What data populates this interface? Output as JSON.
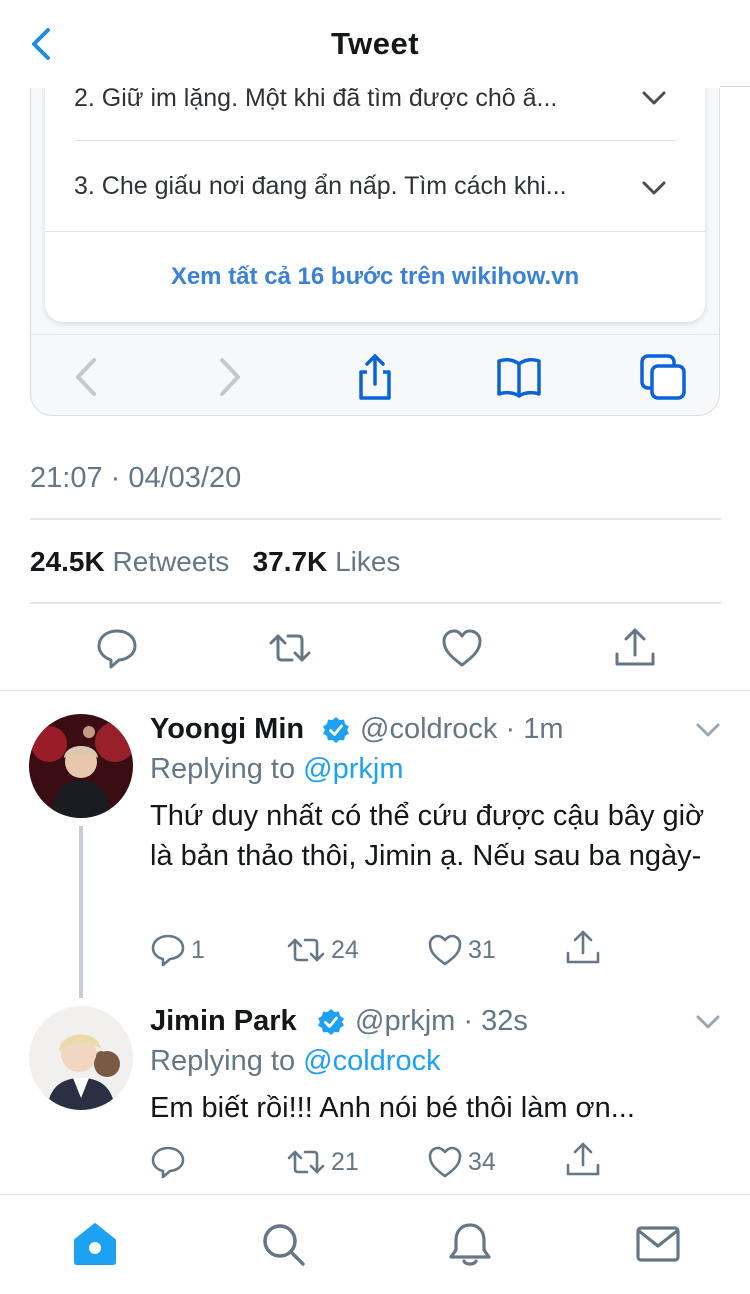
{
  "header": {
    "title": "Tweet",
    "back_icon": "back-chevron-icon"
  },
  "card": {
    "steps": [
      {
        "text": "2.  Giữ im lặng. Một khi đã tìm được chỗ ẩ..."
      },
      {
        "text": "3.  Che giấu nơi đang ẩn nấp. Tìm cách khi..."
      }
    ],
    "see_all": "Xem tất cả 16 bước trên wikihow.vn",
    "toolbar_icons": [
      "back-arrow-icon",
      "forward-arrow-icon",
      "share-icon",
      "bookmarks-icon",
      "tabs-icon"
    ]
  },
  "tweet": {
    "timestamp": "21:07 · 04/03/20",
    "retweets_count": "24.5K",
    "retweets_label": "Retweets",
    "likes_count": "37.7K",
    "likes_label": "Likes"
  },
  "replies": [
    {
      "name": "Yoongi Min",
      "handle": "@coldrock · 1m",
      "replying_label": "Replying to",
      "replying_to": "@prkjm",
      "text": "Thứ duy nhất có thể cứu được cậu bây giờ là bản thảo thôi, Jimin ạ. Nếu sau ba ngày-",
      "replies": "1",
      "retweets": "24",
      "likes": "31"
    },
    {
      "name": "Jimin Park",
      "handle": "@prkjm · 32s",
      "replying_label": "Replying to",
      "replying_to": "@coldrock",
      "text": "Em biết rồi!!! Anh nói bé thôi làm ơn...",
      "replies": "",
      "retweets": "21",
      "likes": "34"
    }
  ],
  "tabbar": [
    "home-icon",
    "search-icon",
    "notifications-icon",
    "messages-icon"
  ],
  "colors": {
    "accent": "#1da1f2",
    "link_blue": "#3a82d8",
    "muted": "#657786",
    "ios_blue": "#0a63d9"
  }
}
